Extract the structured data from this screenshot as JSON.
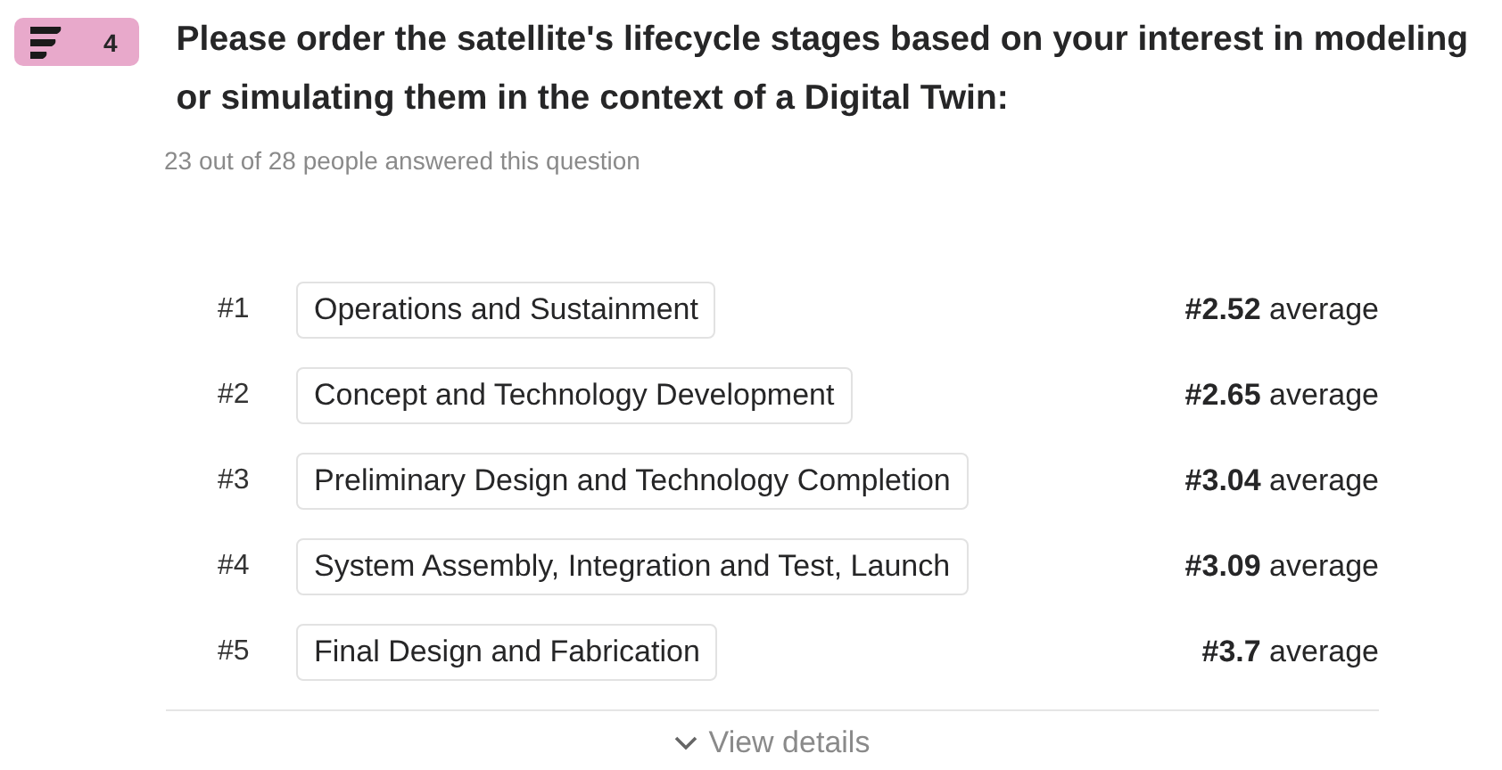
{
  "question": {
    "number": "4",
    "kind": "ranking",
    "title": "Please order the satellite's lifecycle stages based on your interest in modeling or simulating them in the context of a Digital Twin:",
    "answered": "23 out of 28 people answered this question"
  },
  "rankings": [
    {
      "rank": "#1",
      "label": "Operations and Sustainment",
      "average": "**#2.52** average"
    },
    {
      "rank": "#2",
      "label": "Concept and Technology Development",
      "average": "**#2.65** average"
    },
    {
      "rank": "#3",
      "label": "Preliminary Design and Technology Completion",
      "average": "**#3.04** average"
    },
    {
      "rank": "#4",
      "label": "System Assembly, Integration and Test, Launch",
      "average": "**#3.09** average"
    },
    {
      "rank": "#5",
      "label": "Final Design and Fabrication",
      "average": "**#3.7** average"
    }
  ],
  "footer": {
    "link": "View details"
  }
}
